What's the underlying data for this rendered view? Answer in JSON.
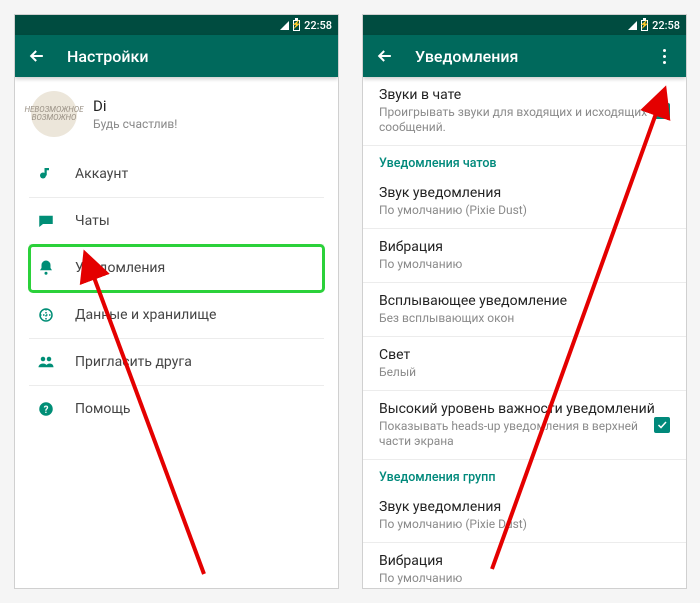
{
  "status_time": "22:58",
  "left": {
    "title": "Настройки",
    "profile": {
      "name": "Di",
      "status": "Будь счастлив!",
      "avatar_text": "НЕВОЗМОЖНОЕ ВОЗМОЖНО"
    },
    "items": [
      {
        "label": "Аккаунт"
      },
      {
        "label": "Чаты"
      },
      {
        "label": "Уведомления"
      },
      {
        "label": "Данные и хранилище"
      },
      {
        "label": "Пригласить друга"
      },
      {
        "label": "Помощь"
      }
    ]
  },
  "right": {
    "title": "Уведомления",
    "rows": [
      {
        "title": "Звуки в чате",
        "sub": "Проигрывать звуки для входящих и исходящих сообщений.",
        "check": true
      },
      {
        "section": "Уведомления чатов"
      },
      {
        "title": "Звук уведомления",
        "sub": "По умолчанию (Pixie Dust)"
      },
      {
        "title": "Вибрация",
        "sub": "По умолчанию"
      },
      {
        "title": "Всплывающее уведомление",
        "sub": "Без всплывающих окон"
      },
      {
        "title": "Свет",
        "sub": "Белый"
      },
      {
        "title": "Высокий уровень важности уведомлений",
        "sub": "Показывать heads-up уведомления в верхней части экрана",
        "check": true
      },
      {
        "section": "Уведомления групп"
      },
      {
        "title": "Звук уведомления",
        "sub": "По умолчанию (Pixie Dust)"
      },
      {
        "title": "Вибрация",
        "sub": "По умолчанию"
      }
    ]
  }
}
